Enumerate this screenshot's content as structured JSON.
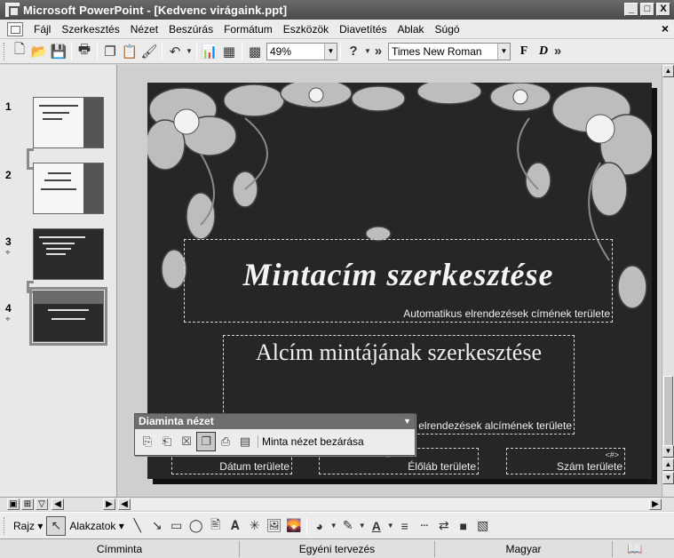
{
  "window": {
    "title": "Microsoft PowerPoint - [Kedvenc virágaink.ppt]",
    "controls": [
      "_",
      "□",
      "X"
    ]
  },
  "menu": {
    "items": [
      "Fájl",
      "Szerkesztés",
      "Nézet",
      "Beszúrás",
      "Formátum",
      "Eszközök",
      "Diavetítés",
      "Ablak",
      "Súgó"
    ],
    "close_glyph": "×"
  },
  "toolbar": {
    "zoom": "49%",
    "font": "Times New Roman",
    "bold_label": "F",
    "italic_label": "D",
    "more_glyph": "»"
  },
  "thumbnails": [
    {
      "number": "1",
      "style": "light"
    },
    {
      "number": "2",
      "style": "light"
    },
    {
      "number": "3",
      "style": "dark",
      "pinned": true
    },
    {
      "number": "4",
      "style": "dark",
      "pinned": true,
      "selected": true
    }
  ],
  "slide": {
    "title": "Mintacím szerkesztése",
    "title_area_label": "Automatikus elrendezések címének területe",
    "subtitle": "Alcím mintájának szerkesztése",
    "subtitle_area_label": "Automatikus elrendezések alcímének területe",
    "date_label": "Dátum területe",
    "footer_label": "Élőláb területe",
    "number_label": "Szám területe",
    "number_marker": "<#>",
    "footer_marker": "<#>"
  },
  "floating_toolbar": {
    "title": "Diaminta nézet",
    "close_button": "Minta nézet bezárása"
  },
  "draw_toolbar": {
    "draw_label": "Rajz",
    "shapes_label": "Alakzatok"
  },
  "status": {
    "cells": [
      "Címminta",
      "Egyéni tervezés",
      "Magyar"
    ]
  },
  "colors": {
    "slide_bg": "#262626",
    "title_bar": "#5a5a5a",
    "chrome": "#ececec"
  }
}
